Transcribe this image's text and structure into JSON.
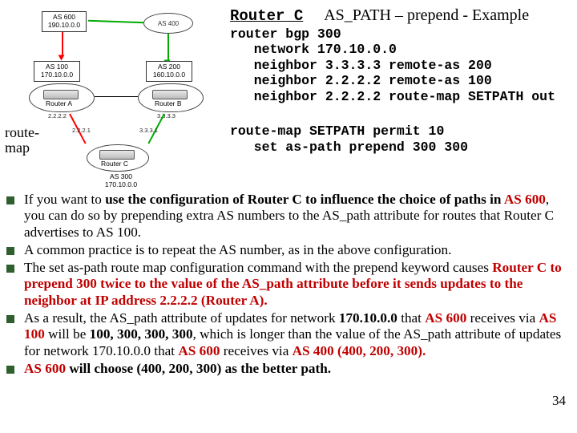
{
  "header": {
    "router_label": "Router C",
    "title": "AS_PATH – prepend - Example"
  },
  "config": {
    "lines": "router bgp 300\n   network 170.10.0.0\n   neighbor 3.3.3.3 remote-as 200\n   neighbor 2.2.2.2 remote-as 100\n   neighbor 2.2.2.2 route-map SETPATH out"
  },
  "routemap_label": "route-map",
  "routemap": {
    "lines": "route-map SETPATH permit 10\n   set as-path prepend 300 300"
  },
  "diagram": {
    "as600": "AS 600\n190.10.0.0",
    "as400": "AS 400",
    "as100": "AS 100\n170.10.0.0",
    "as200": "AS 200\n160.10.0.0",
    "as300": "AS 300\n170.10.0.0",
    "routerA": "Router A",
    "routerB": "Router B",
    "routerC": "Router C",
    "ipA": "2.2.2.2",
    "ipB": "3.3.3.3",
    "ipL": "2.2.2.1",
    "ipR": "3.3.3.1"
  },
  "bullets": [
    {
      "pre": "If you want to ",
      "b1": "use the configuration of Router C to influence the choice of paths in ",
      "r1": "AS 600",
      "post": ", you can do so by prepending extra AS numbers to the AS_path attribute for routes that Router C advertises to AS 100."
    },
    {
      "text": "A common practice is to repeat the AS number, as in the above configuration."
    },
    {
      "pre": "The set as-path route map configuration command with the prepend keyword causes ",
      "r1": "Router C to prepend 300 twice to the value of the AS_path attribute before it sends updates to the neighbor at IP address 2.2.2.2 (Router A).",
      "post": ""
    },
    {
      "pre": "As a result, the AS_path attribute of updates for network ",
      "b1": "170.10.0.0",
      " mid": " that ",
      "r1": "AS 600",
      " mid2": " receives via ",
      "r2": "AS 100",
      " mid3": " will be ",
      "b2": "100, 300, 300, 300",
      " mid4": ", which is longer than the value of the AS_path attribute of updates for network 170.10.0.0 that ",
      "r3": "AS 600",
      " mid5": " receives via ",
      "r4": "AS 400 (400, 200, 300).",
      "post": ""
    },
    {
      "r1": "AS 600",
      " mid": " ",
      "b1": "will choose (400, 200, 300) as the better path.",
      "post": ""
    }
  ],
  "page": "34"
}
